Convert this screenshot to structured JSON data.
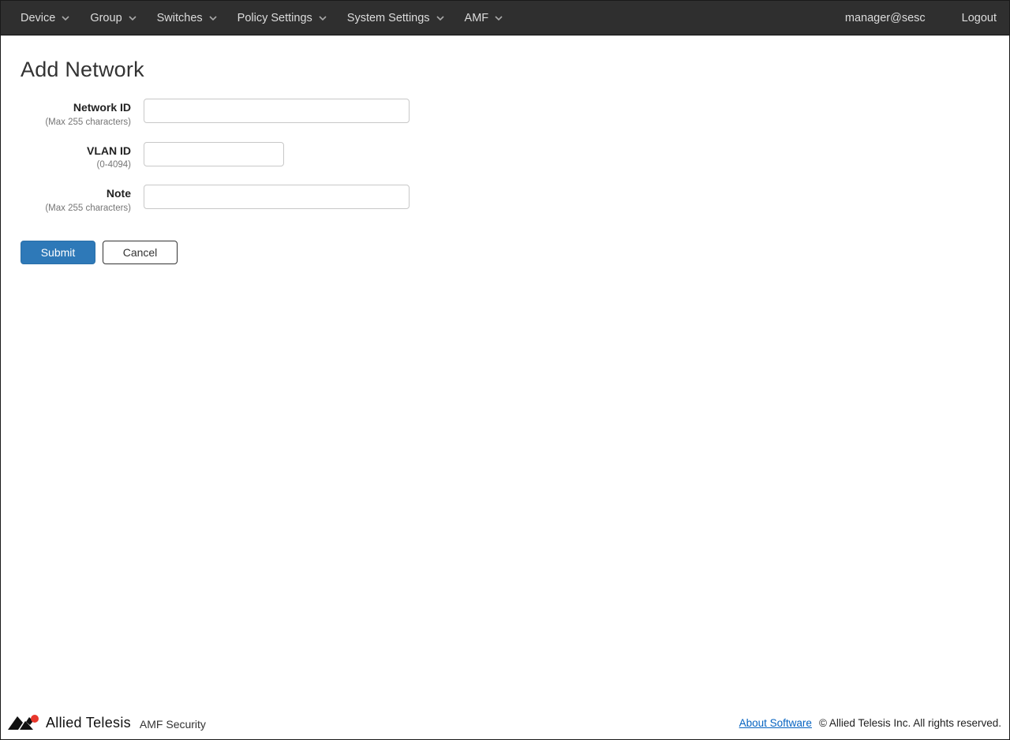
{
  "navbar": {
    "items": [
      {
        "label": "Device"
      },
      {
        "label": "Group"
      },
      {
        "label": "Switches"
      },
      {
        "label": "Policy Settings"
      },
      {
        "label": "System Settings"
      },
      {
        "label": "AMF"
      }
    ],
    "user": "manager@sesc",
    "logout_label": "Logout"
  },
  "page": {
    "title": "Add Network"
  },
  "form": {
    "fields": [
      {
        "label": "Network ID",
        "hint": "(Max 255 characters)",
        "value": ""
      },
      {
        "label": "VLAN ID",
        "hint": "(0-4094)",
        "value": ""
      },
      {
        "label": "Note",
        "hint": "(Max 255 characters)",
        "value": ""
      }
    ],
    "submit_label": "Submit",
    "cancel_label": "Cancel"
  },
  "footer": {
    "brand": "Allied Telesis",
    "product": "AMF Security",
    "about_link": "About Software",
    "copyright": "© Allied Telesis Inc. All rights reserved."
  },
  "colors": {
    "navbar_bg": "#2f2f2f",
    "navbar_text": "#dcdcdc",
    "submit_blue": "#2e79b8",
    "link_blue": "#0563c1",
    "logo_red": "#e8372c",
    "logo_black": "#111111"
  }
}
